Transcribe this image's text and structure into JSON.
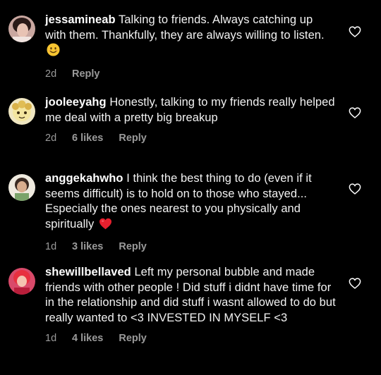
{
  "comments": [
    {
      "username": "jessamineab",
      "text": "Talking to friends. Always catching up with them. Thankfully, they are always willing to listen.",
      "emoji": "smiling-face-emoji",
      "age": "2d",
      "likes": "",
      "reply": "Reply"
    },
    {
      "username": "jooleeyahg",
      "text": "Honestly, talking to my friends really helped me deal with a pretty big breakup",
      "emoji": "",
      "age": "2d",
      "likes": "6 likes",
      "reply": "Reply"
    },
    {
      "username": "anggekahwho",
      "text": "I think the best thing to do (even if it seems difficult) is to hold on to those who stayed... Especially the ones nearest to you physically and spiritually",
      "emoji": "red-heart-emoji",
      "age": "1d",
      "likes": "3 likes",
      "reply": "Reply"
    },
    {
      "username": "shewillbellaved",
      "text": "Left my personal bubble and made friends with other people !  Did stuff i didnt have time for in the relationship and did stuff i wasnt allowed to do but really wanted to <3 INVESTED IN MYSELF <3",
      "emoji": "",
      "age": "1d",
      "likes": "4 likes",
      "reply": "Reply"
    }
  ],
  "colors": {
    "background": "#000000",
    "text": "#f2f2f2",
    "meta": "#9a9a9a",
    "heart_outline": "#ffffff"
  }
}
